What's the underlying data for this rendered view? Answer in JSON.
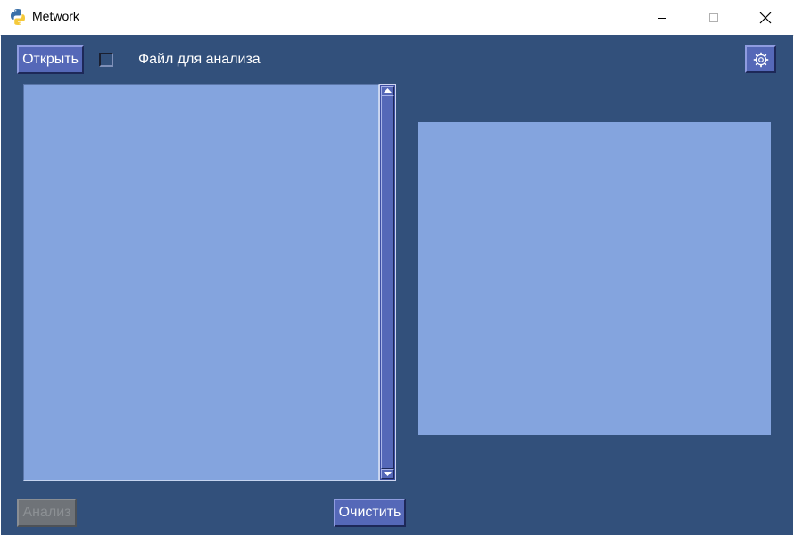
{
  "window": {
    "title": "Metwork",
    "app_icon": "python-icon",
    "controls": [
      "minimize-icon",
      "maximize-icon",
      "close-icon"
    ]
  },
  "toolbar": {
    "open_label": "Открыть",
    "file_checkbox_checked": false,
    "file_label": "Файл для анализа",
    "settings_icon": "gear-icon"
  },
  "footer": {
    "analyze_label": "Анализ",
    "analyze_enabled": false,
    "clear_label": "Очистить"
  },
  "file_list": {
    "items": []
  },
  "colors": {
    "background": "#32507b",
    "panel": "#84a4de",
    "button": "#5568b8",
    "button_disabled": "#6f7378",
    "scrollbar_track": "#3e4fa3"
  }
}
